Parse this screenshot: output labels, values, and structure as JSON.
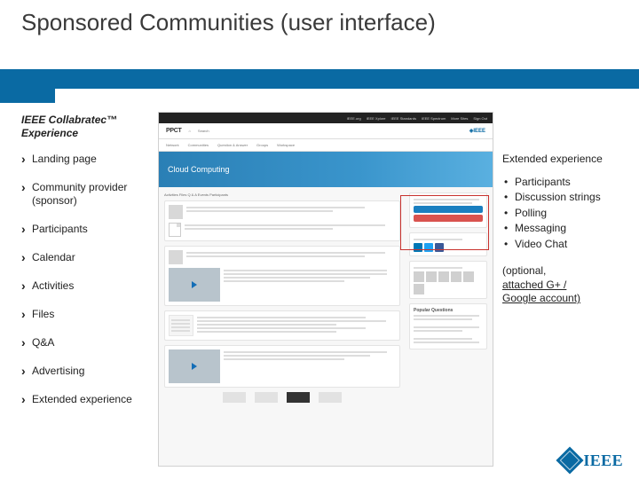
{
  "slide": {
    "title": "Sponsored Communities (user interface)"
  },
  "left": {
    "heading": "IEEE Collabratec™ Experience",
    "items": [
      "Landing page",
      "Community provider (sponsor)",
      "Participants",
      "Calendar",
      "Activities",
      "Files",
      "Q&A",
      "Advertising",
      "Extended experience"
    ]
  },
  "shot": {
    "brand": "PPCT",
    "ieee": "◈IEEE",
    "tabs": [
      "Network",
      "Communities",
      "Question & Answer",
      "Groups",
      "Workspace"
    ],
    "banner": "Cloud Computing",
    "subnav": "Activities    Files    Q & A    Events    Participants",
    "pq": "Popular Questions"
  },
  "right": {
    "heading": "Extended experience",
    "items": [
      "Participants",
      "Discussion strings",
      "Polling",
      "Messaging",
      "Video Chat"
    ],
    "note_open": "(optional,",
    "note_line2": "attached G+ /",
    "note_line3": "Google account)"
  },
  "logo": {
    "text": "IEEE"
  }
}
